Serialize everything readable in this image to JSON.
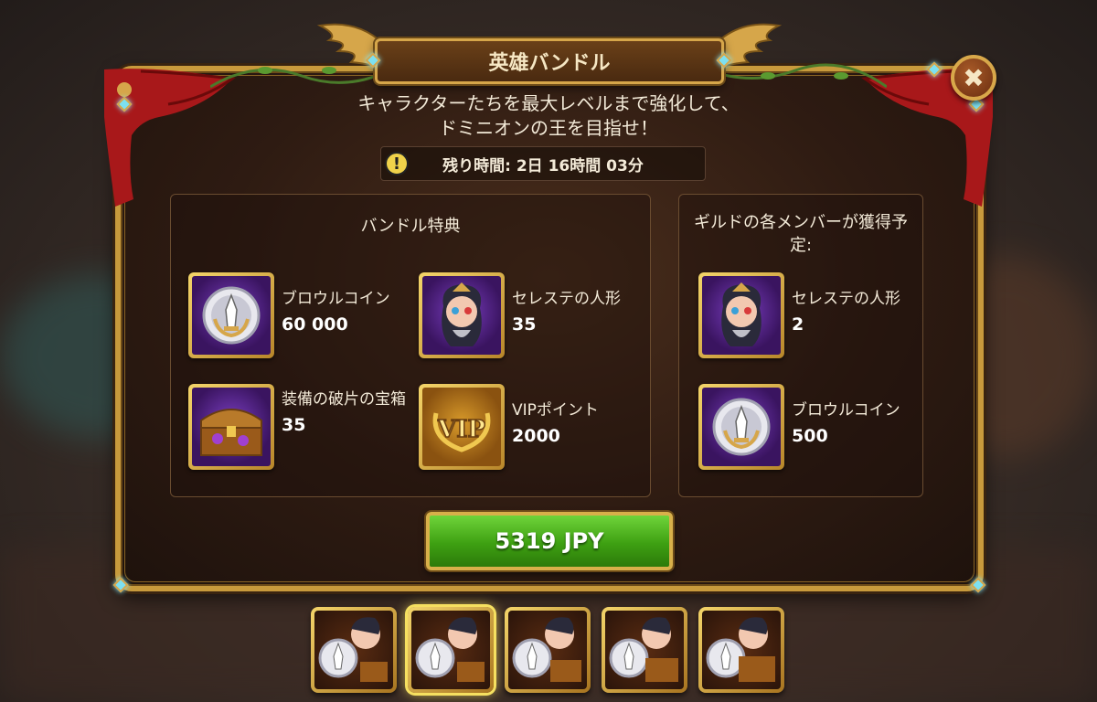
{
  "dialog": {
    "title": "英雄バンドル",
    "subtitle_line1": "キャラクターたちを最大レベルまで強化して、",
    "subtitle_line2": "ドミニオンの王を目指せ！",
    "timer": "残り時間: 2日 16時間 03分",
    "close_icon": "✖"
  },
  "bundle_box": {
    "title": "バンドル特典",
    "items": [
      {
        "name": "ブロウルコイン",
        "qty": "60 000",
        "icon": "brawl-coin-icon"
      },
      {
        "name": "セレステの人形",
        "qty": "35",
        "icon": "celeste-doll-icon"
      },
      {
        "name": "装備の破片の宝箱",
        "qty": "35",
        "icon": "shard-chest-icon"
      },
      {
        "name": "VIPポイント",
        "qty": "2000",
        "icon": "vip-icon"
      }
    ]
  },
  "guild_box": {
    "title": "ギルドの各メンバーが獲得予定:",
    "items": [
      {
        "name": "セレステの人形",
        "qty": "2",
        "icon": "celeste-doll-icon"
      },
      {
        "name": "ブロウルコイン",
        "qty": "500",
        "icon": "brawl-coin-icon"
      }
    ]
  },
  "buy_button": {
    "label": "5319 JPY"
  },
  "colors": {
    "accent_gold": "#d6a64a",
    "buy_green": "#3ea012",
    "panel_bg": "#2e1b12"
  }
}
